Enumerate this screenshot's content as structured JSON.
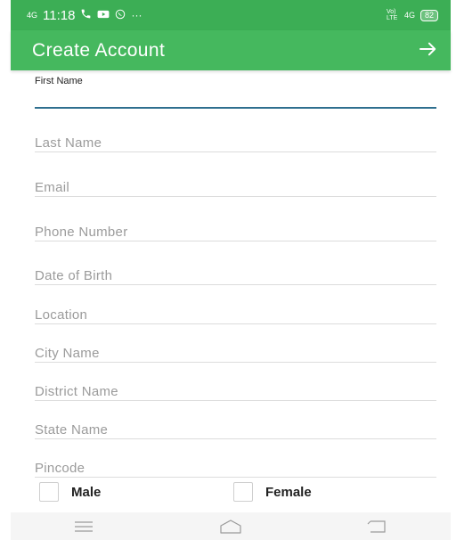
{
  "status_bar": {
    "network": "4G",
    "time": "11:18",
    "overflow": "···",
    "right_network": "4G",
    "right_carrier": "Vo) LTE",
    "battery": "82"
  },
  "app_bar": {
    "title": "Create Account",
    "forward_icon": "arrow-right-icon"
  },
  "form": {
    "first_name": {
      "label": "First Name",
      "value": ""
    },
    "last_name": {
      "placeholder": "Last Name"
    },
    "email": {
      "placeholder": "Email"
    },
    "phone": {
      "placeholder": "Phone Number"
    },
    "dob": {
      "placeholder": "Date of Birth"
    },
    "location": {
      "placeholder": "Location"
    },
    "city": {
      "placeholder": "City Name"
    },
    "district": {
      "placeholder": "District Name"
    },
    "state": {
      "placeholder": "State Name"
    },
    "pincode": {
      "placeholder": "Pincode"
    }
  },
  "gender": {
    "male_label": "Male",
    "female_label": "Female"
  },
  "nav_bar": {
    "icons": [
      "menu-icon",
      "home-icon",
      "back-icon"
    ]
  },
  "colors": {
    "status_bar": "#3cae55",
    "app_bar": "#45b85e",
    "active_underline": "#2f6f8f"
  }
}
